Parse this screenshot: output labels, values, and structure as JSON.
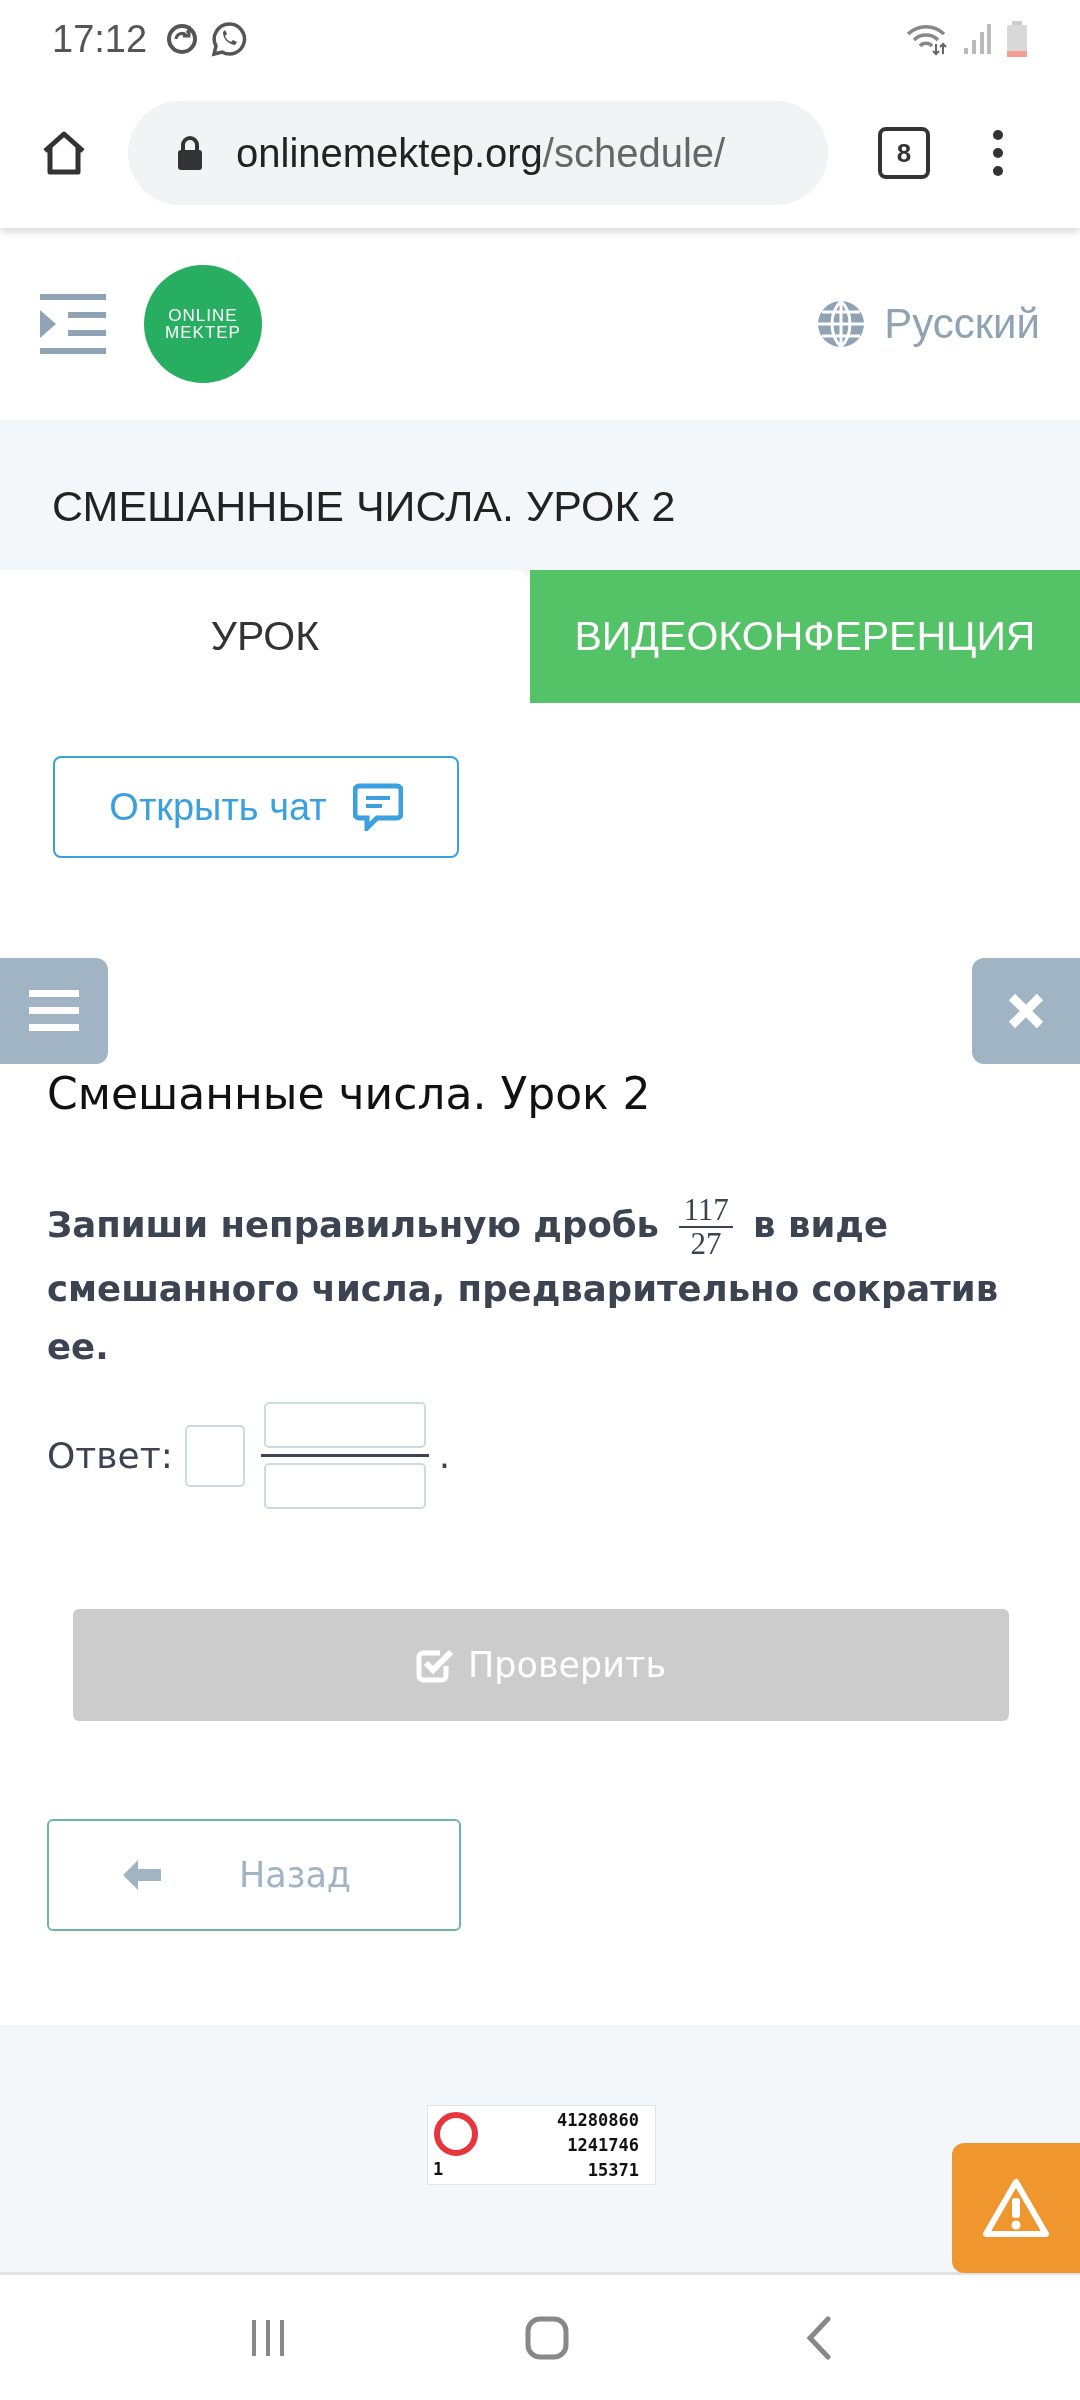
{
  "status_bar": {
    "time": "17:12"
  },
  "browser": {
    "url_host": "onlinemektep.org",
    "url_path": "/schedule/",
    "tab_count": "8"
  },
  "header": {
    "logo_lines": [
      "ONLINE",
      "MEKTEP"
    ],
    "language": "Русский"
  },
  "lesson_title": "СМЕШАННЫЕ ЧИСЛА. УРОК 2",
  "tabs": [
    {
      "label": "УРОК",
      "selected": true
    },
    {
      "label": "ВИДЕОКОНФЕРЕНЦИЯ",
      "selected": false
    }
  ],
  "chat_button": {
    "label": "Открыть чат"
  },
  "task": {
    "heading": "Смешанные числа. Урок 2",
    "question_before": "Запиши неправильную дробь",
    "fraction": {
      "numerator": "117",
      "denominator": "27"
    },
    "question_after": "в виде смешанного числа, предварительно сократив ее.",
    "answer_label": "Ответ:",
    "answer_end": "."
  },
  "check_button": {
    "label": "Проверить",
    "disabled": true
  },
  "back_button": {
    "label": "Назад"
  },
  "counter": {
    "lines": [
      "41280860",
      "1241746",
      "15371"
    ],
    "corner": "1"
  }
}
